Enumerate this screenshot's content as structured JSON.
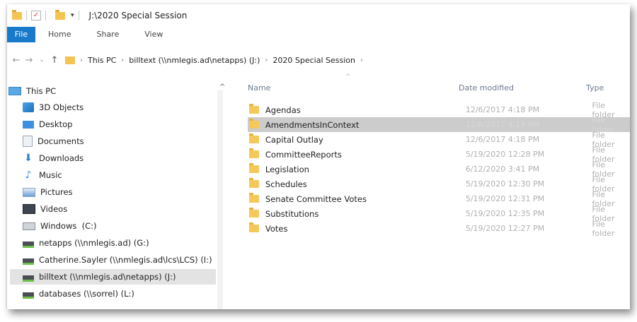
{
  "window": {
    "title": "J:\\2020 Special Session"
  },
  "ribbon": {
    "tabs": [
      "File",
      "Home",
      "Share",
      "View"
    ]
  },
  "address": {
    "crumbs": [
      "This PC",
      "billtext (\\\\nmlegis.ad\\netapps) (J:)",
      "2020 Special Session"
    ],
    "separator": "›"
  },
  "nav_pane": {
    "items": [
      {
        "label": "This PC",
        "icon": "computer-icon"
      },
      {
        "label": "3D Objects",
        "icon": "cube-icon"
      },
      {
        "label": "Desktop",
        "icon": "desktop-icon"
      },
      {
        "label": "Documents",
        "icon": "document-icon"
      },
      {
        "label": "Downloads",
        "icon": "download-arrow-icon"
      },
      {
        "label": "Music",
        "icon": "music-note-icon"
      },
      {
        "label": "Pictures",
        "icon": "picture-icon"
      },
      {
        "label": "Videos",
        "icon": "film-icon"
      },
      {
        "label": "Windows  (C:)",
        "icon": "drive-icon"
      },
      {
        "label": "netapps (\\\\nmlegis.ad) (G:)",
        "icon": "network-drive-icon"
      },
      {
        "label": "Catherine.Sayler (\\\\nmlegis.ad\\lcs\\LCS) (I:)",
        "icon": "network-drive-icon"
      },
      {
        "label": "billtext (\\\\nmlegis.ad\\netapps) (J:)",
        "icon": "network-drive-icon"
      },
      {
        "label": "databases (\\\\sorrel) (L:)",
        "icon": "network-drive-icon"
      }
    ],
    "selected_index": 11
  },
  "content": {
    "columns": {
      "name": "Name",
      "date": "Date modified",
      "type": "Type"
    },
    "rows": [
      {
        "name": "Agendas",
        "date": "12/6/2017 4:18 PM",
        "type": "File folder"
      },
      {
        "name": "AmendmentsInContext",
        "date": "12/6/2017 4:18 PM",
        "type": "File folder"
      },
      {
        "name": "Capital Outlay",
        "date": "12/6/2017 4:18 PM",
        "type": "File folder"
      },
      {
        "name": "CommitteeReports",
        "date": "5/19/2020 12:28 PM",
        "type": "File folder"
      },
      {
        "name": "Legislation",
        "date": "6/12/2020 3:41 PM",
        "type": "File folder"
      },
      {
        "name": "Schedules",
        "date": "5/19/2020 12:30 PM",
        "type": "File folder"
      },
      {
        "name": "Senate Committee Votes",
        "date": "5/19/2020 12:31 PM",
        "type": "File folder"
      },
      {
        "name": "Substitutions",
        "date": "5/19/2020 12:35 PM",
        "type": "File folder"
      },
      {
        "name": "Votes",
        "date": "5/19/2020 12:27 PM",
        "type": "File folder"
      }
    ],
    "selected_index": 1
  },
  "colors": {
    "accent": "#1979ca",
    "folder": "#f5c85a",
    "selection": "#cccccc"
  }
}
